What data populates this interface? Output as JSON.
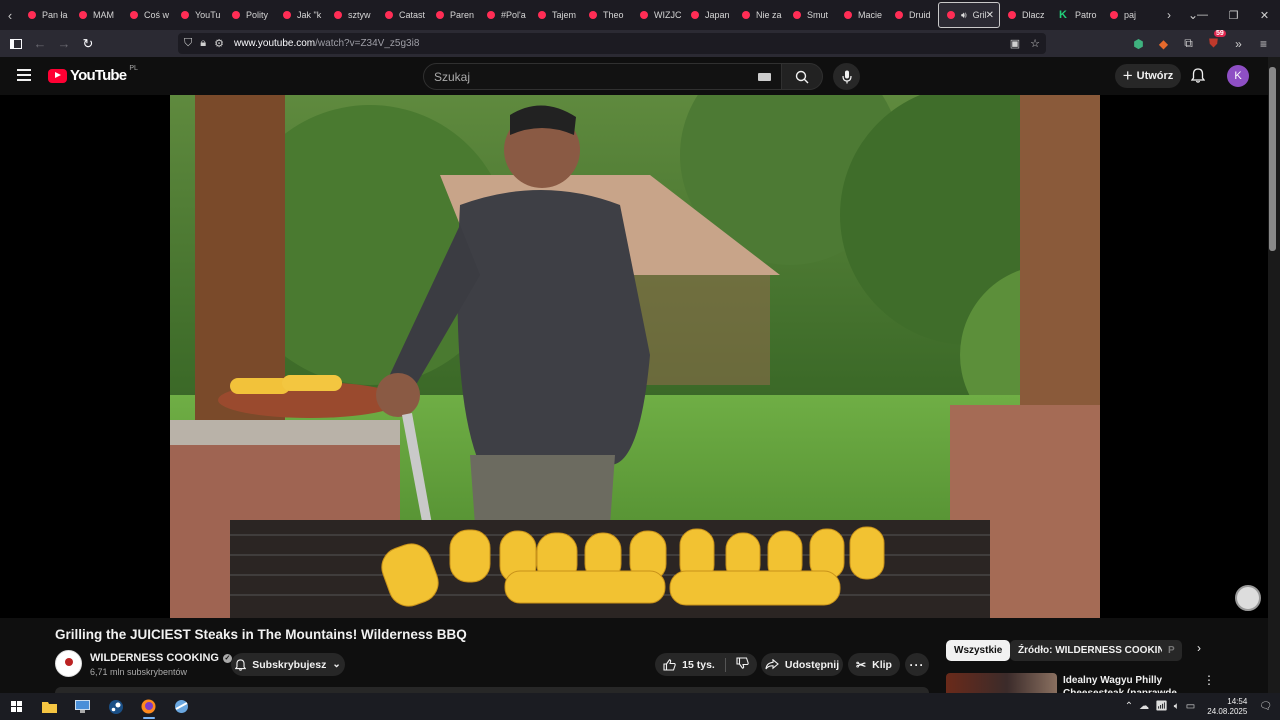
{
  "browser": {
    "tabs": [
      {
        "label": "Pan ła",
        "favicon": "yt"
      },
      {
        "label": "MAM",
        "favicon": "yt"
      },
      {
        "label": "Coś w",
        "favicon": "yt"
      },
      {
        "label": "YouTu",
        "favicon": "yt"
      },
      {
        "label": "Polity",
        "favicon": "yt"
      },
      {
        "label": "Jak \"k",
        "favicon": "yt"
      },
      {
        "label": "sztyw",
        "favicon": "yt"
      },
      {
        "label": "Catast",
        "favicon": "yt"
      },
      {
        "label": "Paren",
        "favicon": "yt"
      },
      {
        "label": "#Pol'a",
        "favicon": "yt"
      },
      {
        "label": "Tajem",
        "favicon": "yt"
      },
      {
        "label": "Theo",
        "favicon": "yt"
      },
      {
        "label": "WIZJC",
        "favicon": "yt"
      },
      {
        "label": "Japan",
        "favicon": "yt"
      },
      {
        "label": "Nie za",
        "favicon": "yt"
      },
      {
        "label": "Smut",
        "favicon": "yt"
      },
      {
        "label": "Macie",
        "favicon": "yt"
      },
      {
        "label": "Druid",
        "favicon": "yt"
      },
      {
        "label": "Gril",
        "favicon": "yt",
        "active": true
      },
      {
        "label": "Dlacz",
        "favicon": "yt"
      },
      {
        "label": "Patro",
        "favicon": "patreon"
      },
      {
        "label": "paj",
        "favicon": "yt"
      }
    ],
    "url_host": "www.youtube.com",
    "url_path": "/watch?v=Z34V_z5g3i8",
    "extension_badge": "59"
  },
  "youtube": {
    "logo_text": "YouTube",
    "country_code": "PL",
    "search_placeholder": "Szukaj",
    "create_label": "Utwórz",
    "avatar_letter": "K",
    "avatar_color": "#8e4fc4"
  },
  "video": {
    "title": "Grilling the JUICIEST Steaks in The Mountains! Wilderness BBQ",
    "channel_name": "WILDERNESS COOKING",
    "subscribers": "6,71 mln subskrybentów",
    "subscribe_label": "Subskrybujesz",
    "likes": "15 tys.",
    "share_label": "Udostępnij",
    "clip_label": "Klip"
  },
  "sidebar": {
    "chips": [
      "Wszystkie",
      "Źródło: WILDERNESS COOKING",
      "P"
    ],
    "rec_title": "Idealny Wagyu Philly Cheesesteak (naprawdę drogi)"
  },
  "taskbar": {
    "time": "14:54",
    "date": "24.08.2025"
  }
}
